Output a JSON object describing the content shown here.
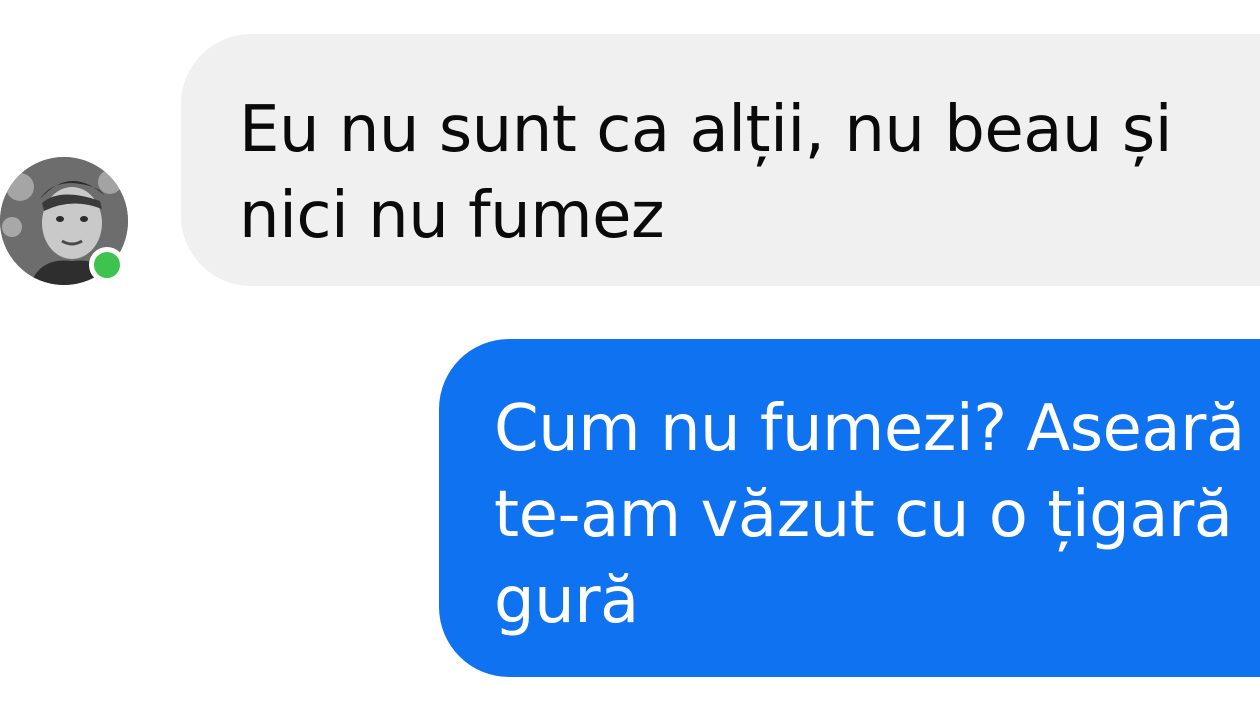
{
  "conversation": {
    "incoming": {
      "avatar_icon": "user-avatar-photo",
      "status": "online",
      "status_color": "#3fc34f",
      "bubble_color": "#f0f0f0",
      "lines": [
        "Eu nu sunt ca alții, nu beau și",
        "nici nu fumez"
      ]
    },
    "outgoing": {
      "bubble_color": "#0f72f1",
      "lines": [
        "Cum nu fumezi? Aseară",
        "te-am văzut cu o țigară",
        "gură"
      ]
    }
  }
}
